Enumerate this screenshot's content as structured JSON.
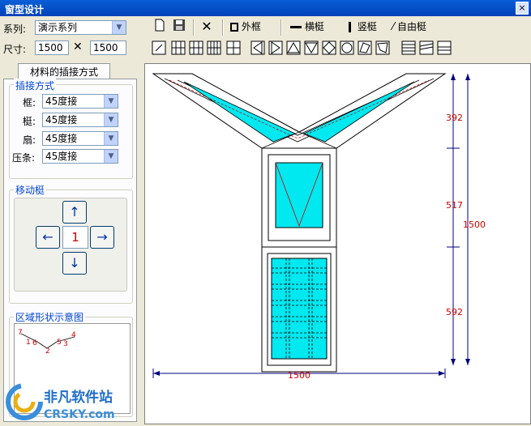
{
  "window": {
    "title": "窗型设计",
    "close_label": "×"
  },
  "form": {
    "series_label": "系列:",
    "series_value": "演示系列",
    "size_label": "尺寸:",
    "width": "1500",
    "times": "✕",
    "height": "1500"
  },
  "tab_label": "材料的插接方式",
  "joint": {
    "title": "插接方式",
    "rows": [
      {
        "label": "框:",
        "value": "45度接"
      },
      {
        "label": "梃:",
        "value": "45度接"
      },
      {
        "label": "扇:",
        "value": "45度接"
      },
      {
        "label": "压条:",
        "value": "45度接"
      }
    ]
  },
  "move": {
    "title": "移动梃",
    "value": "1",
    "up": "↑",
    "down": "↓",
    "left": "←",
    "right": "→"
  },
  "region": {
    "title": "区域形状示意图",
    "labels": [
      "7",
      "1",
      "6",
      "2",
      "5",
      "3",
      "4"
    ]
  },
  "toolbar": {
    "outer_frame": "外框",
    "h_mullion": "横梃",
    "v_mullion": "竖梃",
    "free_mullion": "自由梃"
  },
  "dims": {
    "v1": "392",
    "v2": "517",
    "v3": "592",
    "total_h": "1500",
    "total_w": "1500"
  },
  "watermark": {
    "cn": "非凡软件站",
    "en": "CRSKY.com"
  },
  "colors": {
    "glass": "#00e8f0",
    "dim": "#cc0000",
    "dimline": "#000080"
  }
}
